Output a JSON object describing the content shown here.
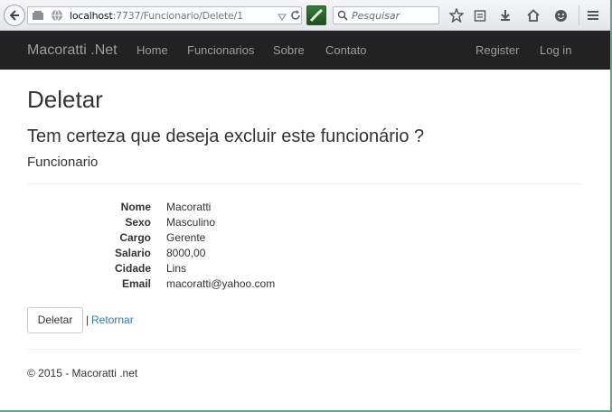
{
  "browser": {
    "url_host": "localhost",
    "url_path": ":7737/Funcionario/Delete/1",
    "search_placeholder": "Pesquisar"
  },
  "navbar": {
    "brand": "Macoratti .Net",
    "links": [
      "Home",
      "Funcionarios",
      "Sobre",
      "Contato"
    ],
    "right_links": [
      "Register",
      "Log in"
    ]
  },
  "page": {
    "title": "Deletar",
    "confirm": "Tem certeza que deseja excluir este funcionário ?",
    "entity": "Funcionario",
    "fields": [
      {
        "label": "Nome",
        "value": "Macoratti"
      },
      {
        "label": "Sexo",
        "value": "Masculino"
      },
      {
        "label": "Cargo",
        "value": "Gerente"
      },
      {
        "label": "Salario",
        "value": "8000,00"
      },
      {
        "label": "Cidade",
        "value": "Lins"
      },
      {
        "label": "Email",
        "value": "macoratti@yahoo.com"
      }
    ],
    "delete_button": "Deletar",
    "separator": "|",
    "back_link": "Retornar",
    "footer": "© 2015 - Macoratti .net"
  },
  "colors": {
    "navbar_bg": "#222222",
    "nav_text": "#9d9d9d",
    "link": "#337ab7"
  }
}
